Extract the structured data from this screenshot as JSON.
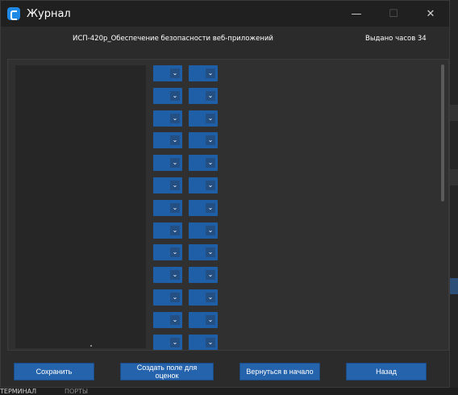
{
  "window": {
    "title": "Журнал",
    "controls": {
      "minimize": "—",
      "maximize": "☐",
      "close": "✕"
    }
  },
  "header": {
    "course_name": "ИСП-420р_Обеспечение безопасности веб-приложений",
    "hours_issued": "Выдано часов 34"
  },
  "grade_rows_visible": 13,
  "grade_select_icon": "chevron-down-icon",
  "buttons": {
    "save": "Сохранить",
    "create_grade_field": "Создать поле для оценок",
    "back_to_start": "Вернуться в начало",
    "back": "Назад"
  },
  "background_app": {
    "tab_terminal": "ТЕРМИНАЛ",
    "tab_ports": "ПОРТЫ"
  },
  "colors": {
    "accent": "#2563ad",
    "window_bg": "#2b2b2b",
    "titlebar_bg": "#202020",
    "panel_bg": "#303030"
  }
}
